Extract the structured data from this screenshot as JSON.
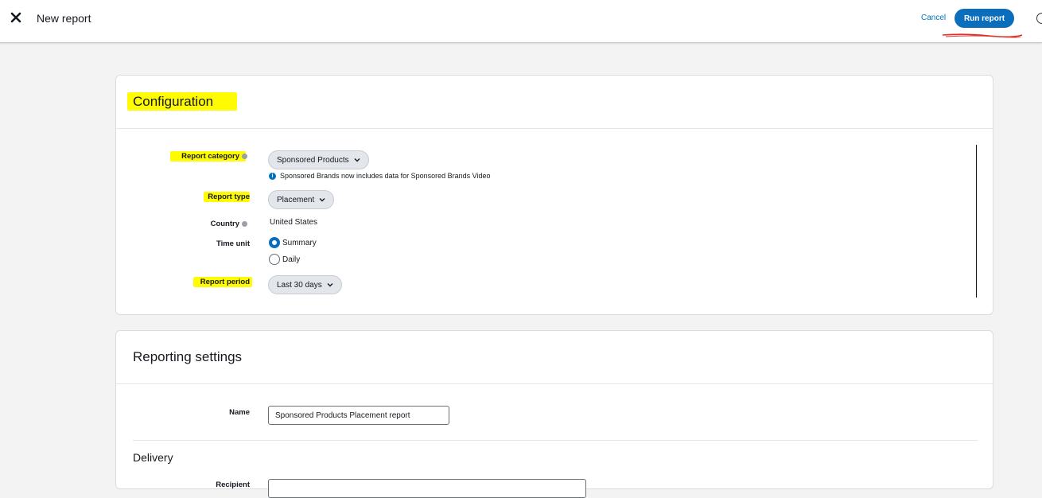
{
  "header": {
    "title": "New report",
    "cancel_label": "Cancel",
    "run_label": "Run report"
  },
  "configuration": {
    "title": "Configuration",
    "fields": {
      "category_label": "Report category",
      "category_value": "Sponsored Products",
      "category_note": "Sponsored Brands now includes data for Sponsored Brands Video",
      "type_label": "Report type",
      "type_value": "Placement",
      "country_label": "Country",
      "country_value": "United States",
      "time_unit_label": "Time unit",
      "time_unit_options": [
        "Summary",
        "Daily"
      ],
      "time_unit_selected": "Summary",
      "period_label": "Report period",
      "period_value": "Last 30 days"
    }
  },
  "reporting_settings": {
    "title": "Reporting settings",
    "name_label": "Name",
    "name_value": "Sponsored Products Placement report",
    "delivery_heading": "Delivery",
    "recipient_label": "Recipient"
  },
  "colors": {
    "accent": "#0a6ebd",
    "link": "#0073bb",
    "highlight": "#fffb00",
    "annotation_red": "#e0302a"
  },
  "icons": {
    "close": "close-icon",
    "help": "help-icon",
    "info": "info-icon",
    "chevron": "chevron-down-icon"
  }
}
